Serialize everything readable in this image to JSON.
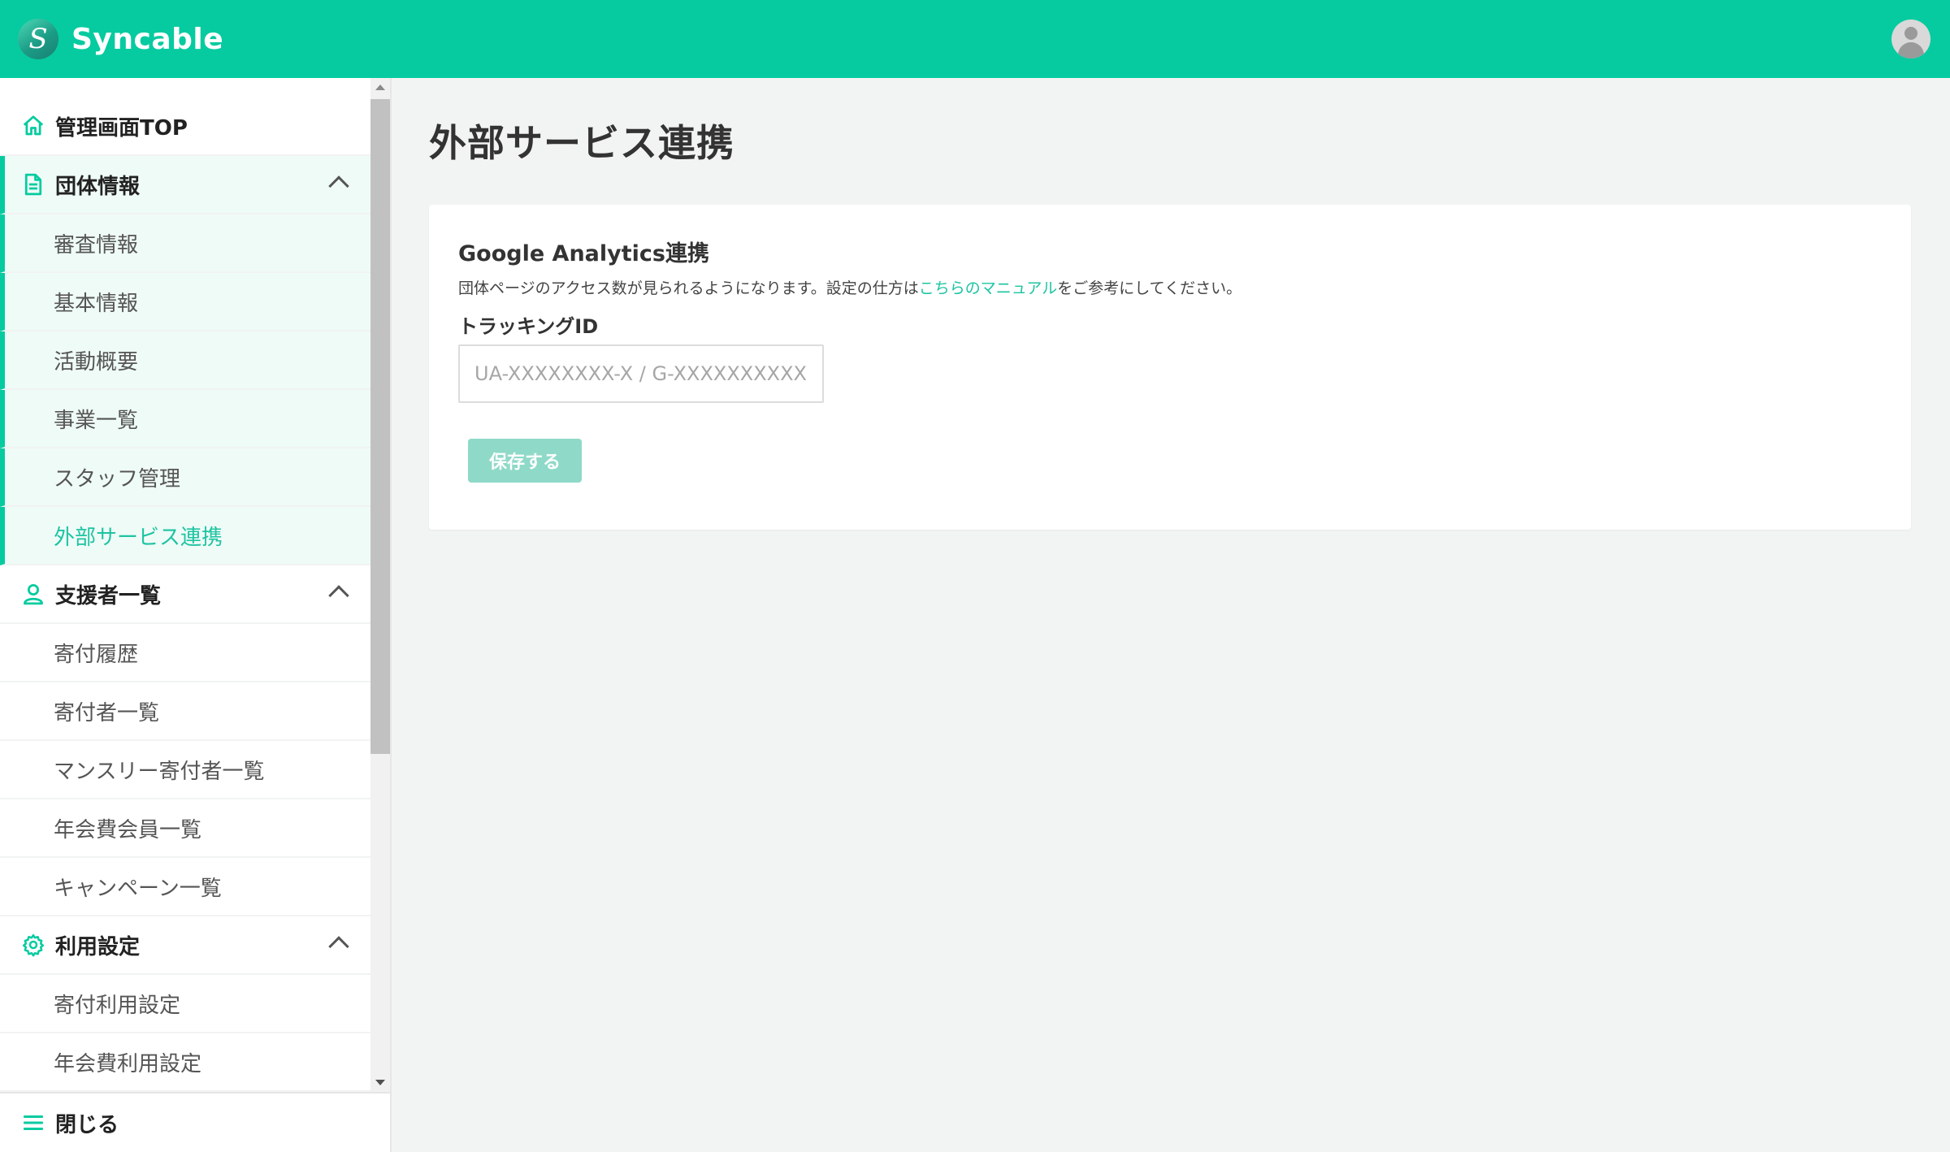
{
  "header": {
    "logo_mark": "S",
    "logo_text": "Syncable",
    "brand_color": "#06cba0"
  },
  "sidebar": {
    "top_item": {
      "label": "管理画面TOP",
      "icon": "home-icon"
    },
    "groups": [
      {
        "label": "団体情報",
        "icon": "document-icon",
        "expanded": true,
        "items": [
          "審査情報",
          "基本情報",
          "活動概要",
          "事業一覧",
          "スタッフ管理",
          "外部サービス連携"
        ],
        "active_item": "外部サービス連携"
      },
      {
        "label": "支援者一覧",
        "icon": "person-icon",
        "expanded": true,
        "items": [
          "寄付履歴",
          "寄付者一覧",
          "マンスリー寄付者一覧",
          "年会費会員一覧",
          "キャンペーン一覧"
        ]
      },
      {
        "label": "利用設定",
        "icon": "gear-icon",
        "expanded": true,
        "items": [
          "寄付利用設定",
          "年会費利用設定"
        ]
      }
    ],
    "close_label": "閉じる"
  },
  "main": {
    "page_title": "外部サービス連携",
    "card": {
      "title": "Google Analytics連携",
      "desc_before": "団体ページのアクセス数が見られるようになります。設定の仕方は",
      "desc_link": "こちらのマニュアル",
      "desc_after": "をご参考にしてください。",
      "field_label": "トラッキングID",
      "input_value": "",
      "input_placeholder": "UA-XXXXXXXX-X / G-XXXXXXXXXX",
      "save_label": "保存する"
    }
  },
  "colors": {
    "accent": "#06cba0",
    "link": "#1ec4a2",
    "save_disabled": "#8fd9c8",
    "active_bg": "#effbf7"
  }
}
